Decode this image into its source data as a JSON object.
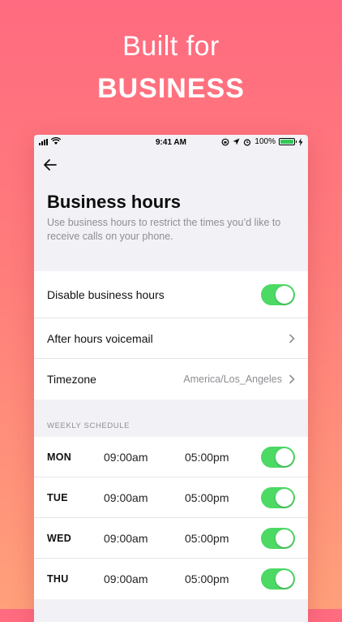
{
  "headline": {
    "line1": "Built for",
    "line2": "BUSINESS"
  },
  "status_bar": {
    "time": "9:41 AM",
    "battery": "100%"
  },
  "screen": {
    "title": "Business hours",
    "subtitle": "Use business hours to restrict the times you’d like to receive calls on your phone."
  },
  "settings": {
    "disable_label": "Disable business hours",
    "voicemail_label": "After hours voicemail",
    "timezone_label": "Timezone",
    "timezone_value": "America/Los_Angeles"
  },
  "schedule": {
    "header": "WEEKLY SCHEDULE",
    "days": [
      {
        "day": "MON",
        "start": "09:00am",
        "end": "05:00pm",
        "enabled": true
      },
      {
        "day": "TUE",
        "start": "09:00am",
        "end": "05:00pm",
        "enabled": true
      },
      {
        "day": "WED",
        "start": "09:00am",
        "end": "05:00pm",
        "enabled": true
      },
      {
        "day": "THU",
        "start": "09:00am",
        "end": "05:00pm",
        "enabled": true
      }
    ]
  },
  "colors": {
    "toggle_on": "#4cd964",
    "background_top": "#ff6b80",
    "background_bottom": "#ffa07a"
  }
}
